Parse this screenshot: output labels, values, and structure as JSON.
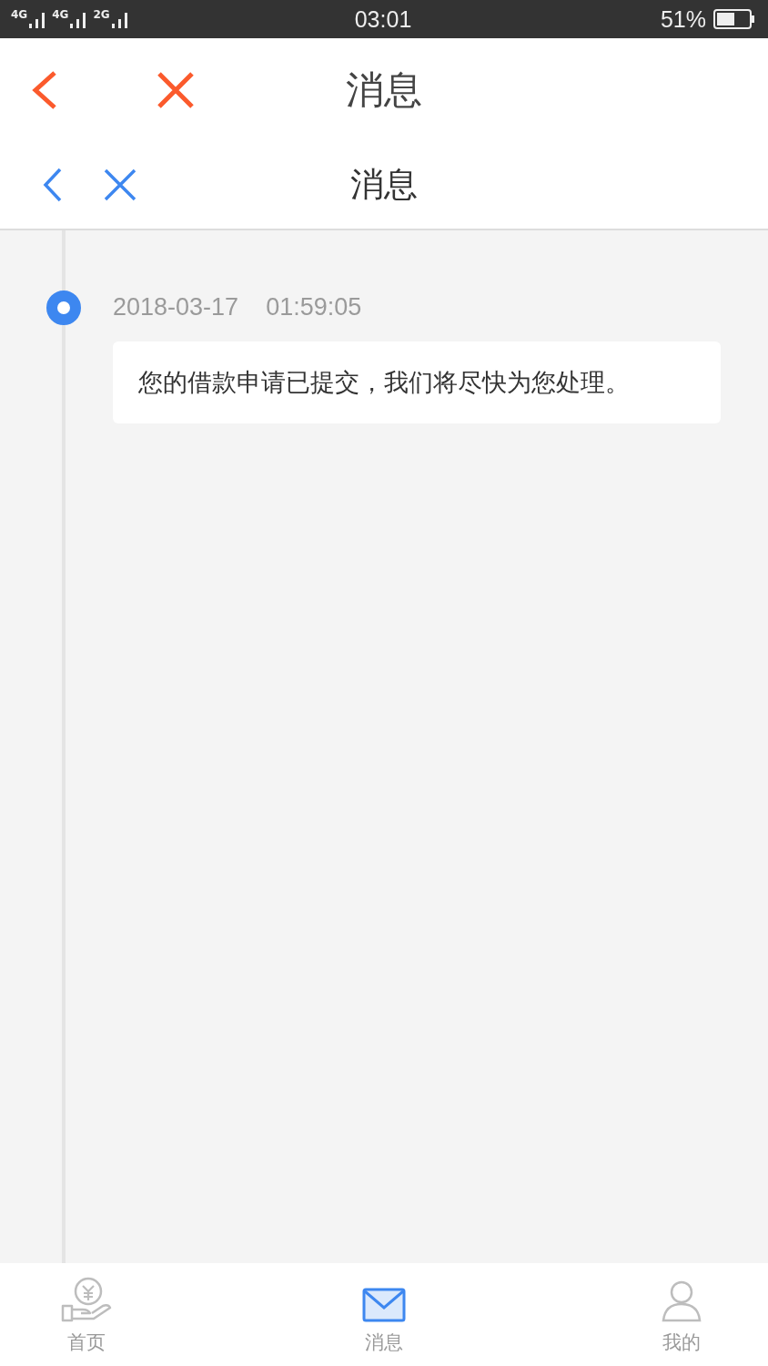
{
  "status_bar": {
    "network_labels": [
      "4G",
      "4G",
      "2G"
    ],
    "time": "03:01",
    "battery": "51%"
  },
  "header": {
    "title": "消息"
  },
  "sub_header": {
    "title": "消息"
  },
  "timeline": [
    {
      "date": "2018-03-17",
      "time": "01:59:05",
      "message": "您的借款申请已提交，我们将尽快为您处理。",
      "active": true
    }
  ],
  "tab_bar": [
    {
      "kind": "home",
      "label": "首页",
      "selected": false
    },
    {
      "kind": "messages",
      "label": "消息",
      "selected": true
    },
    {
      "kind": "profile",
      "label": "我的",
      "selected": false
    }
  ]
}
